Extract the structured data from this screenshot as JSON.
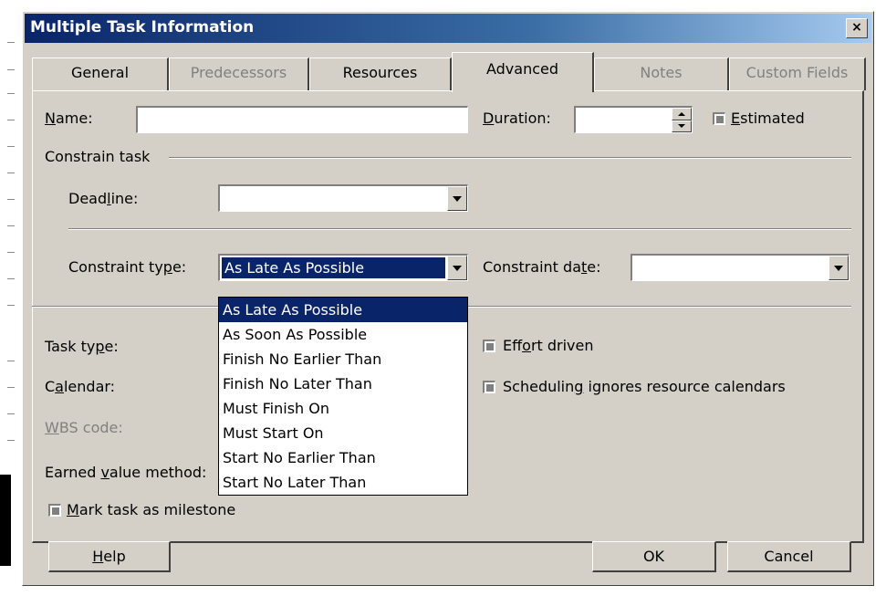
{
  "dialog": {
    "title": "Multiple Task Information",
    "close_label": "×"
  },
  "tabs": [
    {
      "label": "General",
      "enabled": true,
      "active": false
    },
    {
      "label": "Predecessors",
      "enabled": false,
      "active": false
    },
    {
      "label": "Resources",
      "enabled": true,
      "active": false
    },
    {
      "label": "Advanced",
      "enabled": true,
      "active": true
    },
    {
      "label": "Notes",
      "enabled": false,
      "active": false
    },
    {
      "label": "Custom Fields",
      "enabled": false,
      "active": false
    }
  ],
  "fields": {
    "name": {
      "label_pre": "",
      "label_u": "N",
      "label_post": "ame:",
      "value": ""
    },
    "duration": {
      "label_pre": "",
      "label_u": "D",
      "label_post": "uration:",
      "value": ""
    },
    "estimated": {
      "label_pre": "",
      "label_u": "E",
      "label_post": "stimated"
    },
    "constrain_task": "Constrain task",
    "deadline": {
      "label_pre": "Dead",
      "label_u": "l",
      "label_post": "ine:",
      "value": ""
    },
    "constraint_type": {
      "label_pre": "Constraint ty",
      "label_u": "p",
      "label_post": "e:",
      "value": "As Late As Possible"
    },
    "constraint_date": {
      "label_pre": "Constraint da",
      "label_u": "t",
      "label_post": "e:",
      "value": ""
    },
    "task_type": {
      "label_pre": "Task ty",
      "label_u": "p",
      "label_post": "e:"
    },
    "effort_driven": {
      "label_pre": "Eff",
      "label_u": "o",
      "label_post": "rt driven"
    },
    "calendar": {
      "label_pre": "C",
      "label_u": "a",
      "label_post": "lendar:"
    },
    "scheduling_ignores": {
      "label_pre": "Schedulin",
      "label_u": "g",
      "label_post": " ignores resource calendars"
    },
    "wbs_code": {
      "label_pre": "",
      "label_u": "W",
      "label_post": "BS code:"
    },
    "earned_value": {
      "label_pre": "Earned ",
      "label_u": "v",
      "label_post": "alue method:"
    },
    "milestone": {
      "label_pre": "",
      "label_u": "M",
      "label_post": "ark task as milestone"
    }
  },
  "constraint_options": [
    "As Late As Possible",
    "As Soon As Possible",
    "Finish No Earlier Than",
    "Finish No Later Than",
    "Must Finish On",
    "Must Start On",
    "Start No Earlier Than",
    "Start No Later Than"
  ],
  "buttons": {
    "help": {
      "label_pre": "",
      "label_u": "H",
      "label_post": "elp"
    },
    "ok": "OK",
    "cancel": "Cancel"
  },
  "colors": {
    "dialog_face": "#d4d0c8",
    "title_gradient_start": "#0a246a",
    "selection": "#0a246a"
  }
}
